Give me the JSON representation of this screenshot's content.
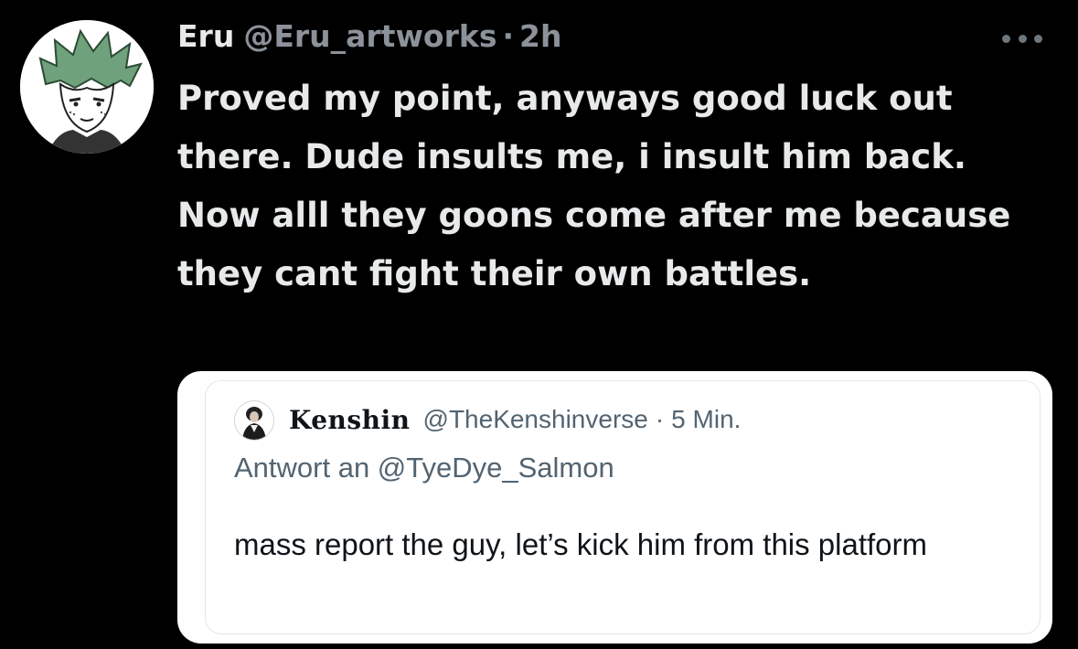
{
  "tweet": {
    "author_name": "Eru",
    "author_handle": "@Eru_artworks",
    "separator": "·",
    "time": "2h",
    "text": "Proved my point, anyways good luck out there. Dude insults me, i insult him back. Now alll they goons come after me because they cant fight their own battles."
  },
  "quoted_tweet": {
    "author_name": "Kenshin",
    "author_handle": "@TheKenshinverse",
    "separator": "·",
    "time": "5 Min.",
    "reply_to": "Antwort an @TyeDye_Salmon",
    "text": "mass report the guy, let’s kick him from this platform"
  },
  "icons": {
    "avatar": "avatar-image",
    "more": "more-options-icon",
    "quoted_avatar": "avatar-image"
  },
  "colors": {
    "background": "#000000",
    "primary_text": "#e7e9ea",
    "secondary_text": "#8b9299",
    "quote_background": "#ffffff",
    "quote_text": "#0f1419",
    "quote_secondary_text": "#536471"
  }
}
